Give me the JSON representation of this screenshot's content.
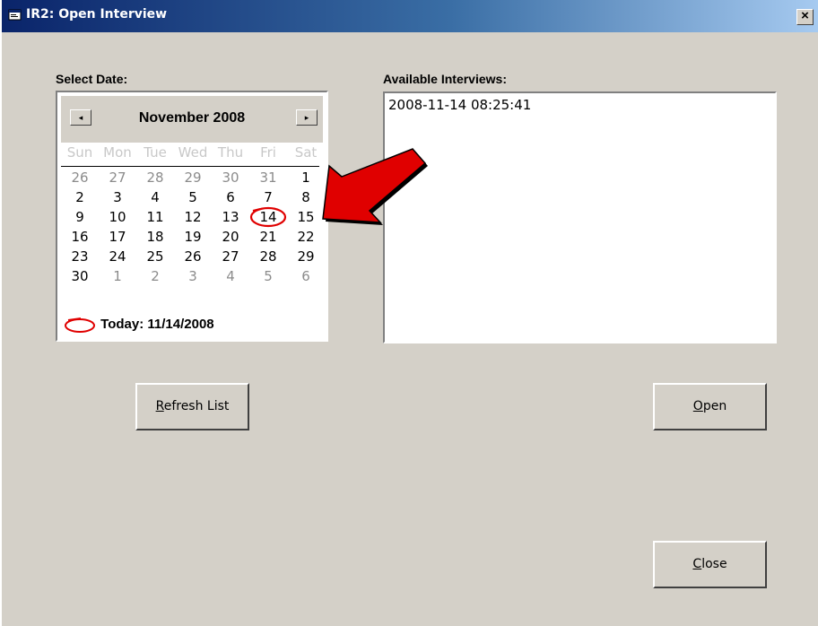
{
  "window": {
    "title": "IR2: Open Interview",
    "close_label": "×"
  },
  "date_panel": {
    "label": "Select Date:",
    "month_title": "November 2008",
    "prev_label": "◂",
    "next_label": "▸",
    "weekdays": [
      "Sun",
      "Mon",
      "Tue",
      "Wed",
      "Thu",
      "Fri",
      "Sat"
    ],
    "weeks": [
      [
        "26",
        "27",
        "28",
        "29",
        "30",
        "31",
        "1"
      ],
      [
        "2",
        "3",
        "4",
        "5",
        "6",
        "7",
        "8"
      ],
      [
        "9",
        "10",
        "11",
        "12",
        "13",
        "14",
        "15"
      ],
      [
        "16",
        "17",
        "18",
        "19",
        "20",
        "21",
        "22"
      ],
      [
        "23",
        "24",
        "25",
        "26",
        "27",
        "28",
        "29"
      ],
      [
        "30",
        "1",
        "2",
        "3",
        "4",
        "5",
        "6"
      ]
    ],
    "selected_day": "14",
    "today_label": "Today: 11/14/2008"
  },
  "interviews_panel": {
    "label": "Available Interviews:",
    "items": [
      "2008-11-14 08:25:41"
    ]
  },
  "buttons": {
    "refresh": {
      "mnemonic": "R",
      "rest": "efresh List"
    },
    "open": {
      "mnemonic": "O",
      "rest": "pen"
    },
    "close": {
      "mnemonic": "C",
      "rest": "lose"
    }
  },
  "colors": {
    "annotation_red": "#e00000",
    "title_blue": "#0a246a"
  }
}
